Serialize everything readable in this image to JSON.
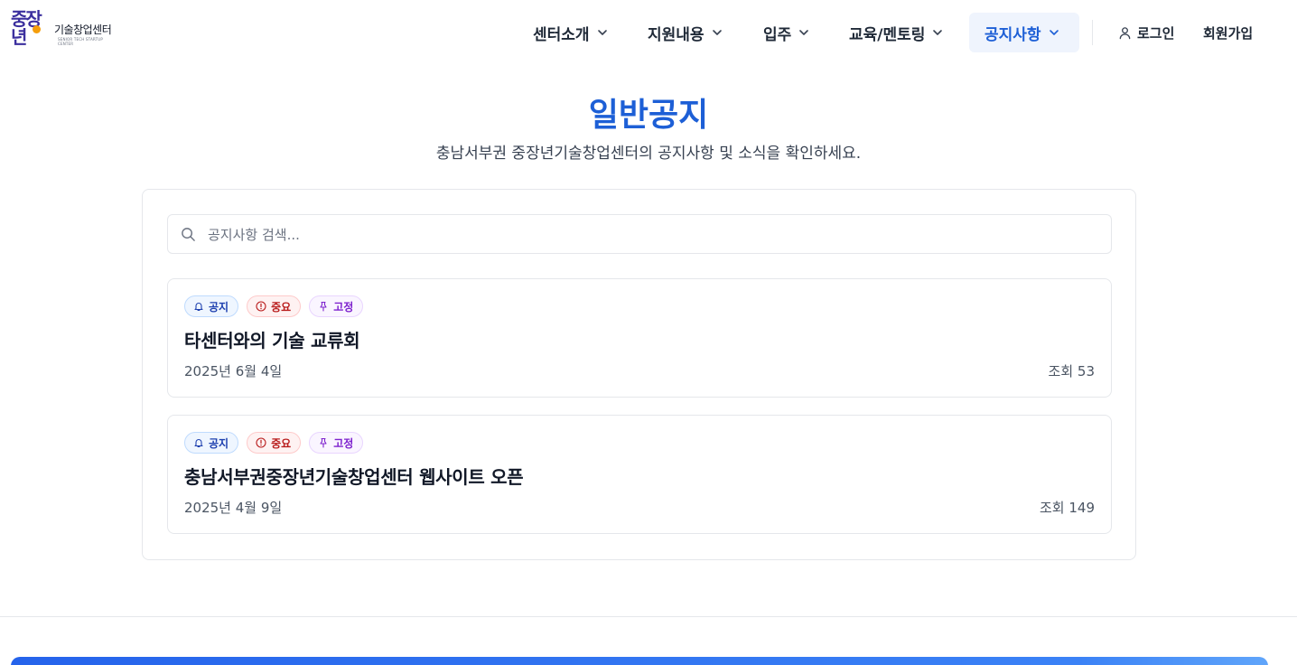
{
  "logo": {
    "big_line1": "중장",
    "big_line2": "년",
    "name": "기술창업센터",
    "tagline": "SENIOR TECH STARTUP CENTER"
  },
  "nav": {
    "items": [
      {
        "label": "센터소개",
        "icon": "chevron-down-icon"
      },
      {
        "label": "지원내용",
        "icon": "chevron-down-icon"
      },
      {
        "label": "입주",
        "icon": "chevron-down-icon"
      },
      {
        "label": "교육/멘토링",
        "icon": "chevron-down-icon"
      },
      {
        "label": "공지사항",
        "icon": "chevron-down-icon",
        "active": true
      }
    ],
    "login_label": "로그인",
    "signup_label": "회원가입"
  },
  "page": {
    "title": "일반공지",
    "subtitle": "충남서부권 중장년기술창업센터의 공지사항 및 소식을 확인하세요."
  },
  "search": {
    "placeholder": "공지사항 검색...",
    "value": ""
  },
  "notices": [
    {
      "badges": [
        {
          "label": "공지",
          "icon": "bell-icon"
        },
        {
          "label": "중요",
          "icon": "alert-circle-icon"
        },
        {
          "label": "고정",
          "icon": "pin-icon"
        }
      ],
      "title": "타센터와의 기술 교류회",
      "date": "2025년 6월 4일",
      "views": "조회 53"
    },
    {
      "badges": [
        {
          "label": "공지",
          "icon": "bell-icon"
        },
        {
          "label": "중요",
          "icon": "alert-circle-icon"
        },
        {
          "label": "고정",
          "icon": "pin-icon"
        }
      ],
      "title": "충남서부권중장년기술창업센터 웹사이트 오픈",
      "date": "2025년 4월 9일",
      "views": "조회 149"
    }
  ],
  "colors": {
    "accent": "#1d5fd6",
    "active_nav_bg": "#eff4fd",
    "badge_blue": "#1e40af",
    "badge_red": "#b91c1c",
    "badge_purple": "#7e22ce"
  }
}
